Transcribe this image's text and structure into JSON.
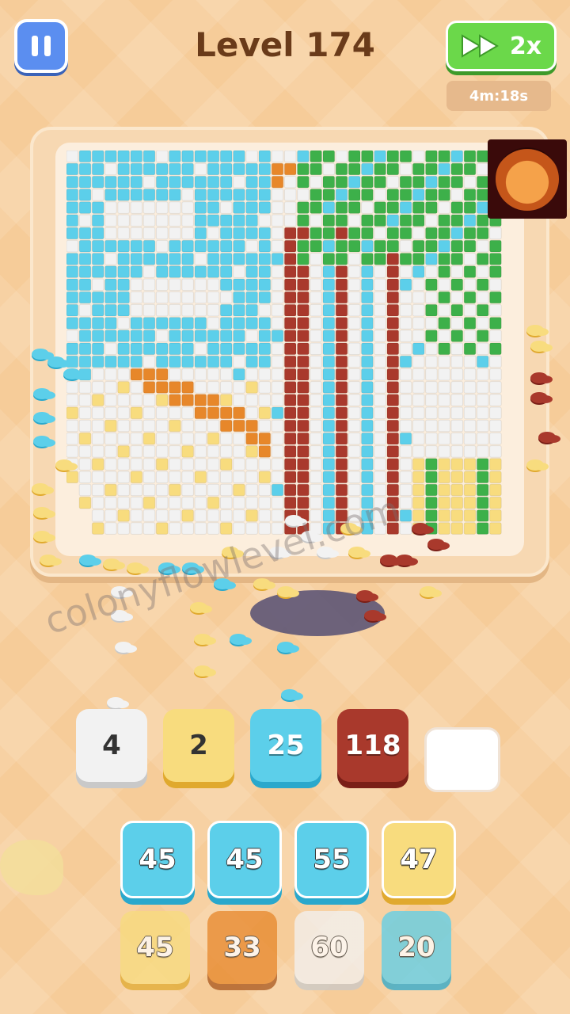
{
  "header": {
    "level_title": "Level 174",
    "speed_label": "2x",
    "timer": "4m:18s"
  },
  "icons": {
    "pause": "pause-icon",
    "speed": "fast-forward-icon",
    "avatar": "tiger-avatar"
  },
  "watermark": "colonyflowlevel.com",
  "colors": {
    "white": "#f2f2f2",
    "yellow": "#f8dc7e",
    "sky": "#5ccfea",
    "brown": "#a9392c",
    "orange": "#e7872a",
    "green": "#3db04a",
    "trunk": "#c0562c",
    "background": "#f6cc99"
  },
  "tray_slots": [
    {
      "value": "4",
      "color": "white"
    },
    {
      "value": "2",
      "color": "yellow"
    },
    {
      "value": "25",
      "color": "sky"
    },
    {
      "value": "118",
      "color": "brown"
    },
    {
      "value": "",
      "color": "empty"
    }
  ],
  "tile_rows": [
    [
      {
        "value": "45",
        "color": "sky"
      },
      {
        "value": "45",
        "color": "sky"
      },
      {
        "value": "55",
        "color": "sky"
      },
      {
        "value": "47",
        "color": "yellow"
      }
    ],
    [
      {
        "value": "45",
        "color": "yellow"
      },
      {
        "value": "33",
        "color": "orange"
      },
      {
        "value": "60",
        "color": "white"
      },
      {
        "value": "20",
        "color": "sky"
      }
    ]
  ]
}
